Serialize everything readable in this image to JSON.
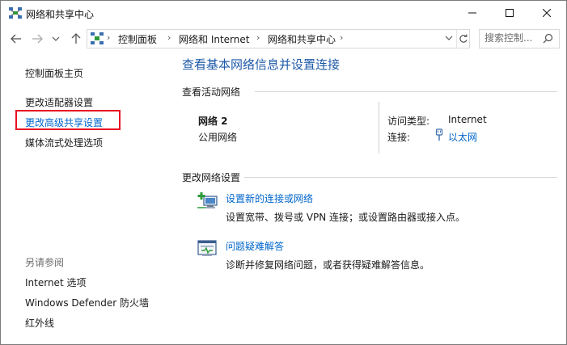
{
  "window": {
    "title": "网络和共享中心"
  },
  "address": {
    "crumbs": [
      "控制面板",
      "网络和 Internet",
      "网络和共享中心"
    ],
    "search_placeholder": "搜索控制..."
  },
  "left": {
    "home": "控制面板主页",
    "links": [
      "更改适配器设置",
      "更改高级共享设置",
      "媒体流式处理选项"
    ],
    "see_also_title": "另请参阅",
    "see_also": [
      "Internet 选项",
      "Windows Defender 防火墙",
      "红外线"
    ]
  },
  "main": {
    "heading": "查看基本网络信息并设置连接",
    "active_title": "查看活动网络",
    "network": {
      "name": "网络 2",
      "category": "公用网络",
      "access_label": "访问类型:",
      "access_value": "Internet",
      "conn_label": "连接:",
      "conn_value": "以太网"
    },
    "change_title": "更改网络设置",
    "tasks": [
      {
        "icon": "new-connection-icon",
        "link": "设置新的连接或网络",
        "desc": "设置宽带、拨号或 VPN 连接；或设置路由器或接入点。"
      },
      {
        "icon": "troubleshoot-icon",
        "link": "问题疑难解答",
        "desc": "诊断并修复网络问题，或者获得疑难解答信息。"
      }
    ]
  },
  "colors": {
    "accent": "#1e5aa8",
    "link": "#0066cc",
    "highlight": "#e81123"
  }
}
